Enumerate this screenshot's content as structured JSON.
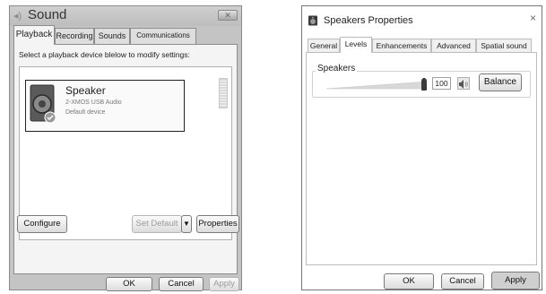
{
  "sound_window": {
    "title": "Sound",
    "tabs": [
      "Playback",
      "Recording",
      "Sounds",
      "Communications"
    ],
    "active_tab": "Playback",
    "instruction": "Select a playback device blelow to modify settings:",
    "device": {
      "name": "Speaker",
      "model": "2-XMOS USB Audio",
      "status": "Default device"
    },
    "buttons": {
      "configure": "Configure",
      "set_default": "Set Default",
      "properties": "Properties",
      "ok": "OK",
      "cancel": "Cancel",
      "apply": "Apply"
    }
  },
  "props_window": {
    "title": "Speakers Properties",
    "close_glyph": "×",
    "tabs": [
      "General",
      "Levels",
      "Enhancements",
      "Advanced",
      "Spatial sound"
    ],
    "active_tab": "Levels",
    "group_label": "Speakers",
    "volume": "100",
    "volume_level": 1.0,
    "buttons": {
      "balance": "Balance",
      "ok": "OK",
      "cancel": "Cancel",
      "apply": "Apply"
    }
  }
}
